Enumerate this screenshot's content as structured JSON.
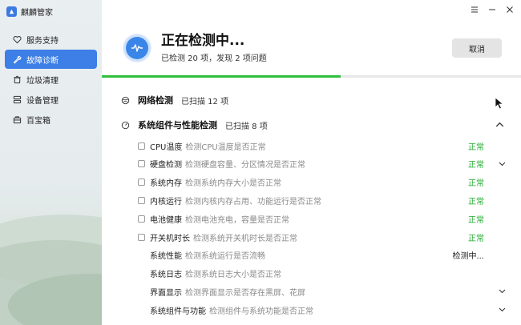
{
  "app": {
    "name": "麒麟管家"
  },
  "sidebar": {
    "items": [
      {
        "label": "服务支持",
        "icon": "heart-icon",
        "active": false
      },
      {
        "label": "故障诊断",
        "icon": "wrench-icon",
        "active": true
      },
      {
        "label": "垃圾清理",
        "icon": "trash-icon",
        "active": false
      },
      {
        "label": "设备管理",
        "icon": "device-icon",
        "active": false
      },
      {
        "label": "百宝箱",
        "icon": "toolbox-icon",
        "active": false
      }
    ]
  },
  "header": {
    "title": "正在检测中...",
    "subtitle": "已检测 20 项，发现 2 项问题",
    "cancel_label": "取消",
    "progress": 0.57
  },
  "sections": [
    {
      "title": "网络检测",
      "meta": "已扫描 12 项"
    },
    {
      "title": "系统组件与性能检测",
      "meta": "已扫描 8 项"
    }
  ],
  "rows": [
    {
      "name": "CPU温度",
      "desc": "检测CPU温度是否正常",
      "status": "正常",
      "state": "ok",
      "checkbox": true,
      "chevron": false
    },
    {
      "name": "硬盘检测",
      "desc": "检测硬盘容量、分区情况是否正常",
      "status": "正常",
      "state": "ok",
      "checkbox": true,
      "chevron": true
    },
    {
      "name": "系统内存",
      "desc": "检测系统内存大小是否正常",
      "status": "正常",
      "state": "ok",
      "checkbox": true,
      "chevron": false
    },
    {
      "name": "内核运行",
      "desc": "检测内核内存占用、功能运行是否正常",
      "status": "正常",
      "state": "ok",
      "checkbox": true,
      "chevron": false
    },
    {
      "name": "电池健康",
      "desc": "检测电池充电，容量是否正常",
      "status": "正常",
      "state": "ok",
      "checkbox": true,
      "chevron": false
    },
    {
      "name": "开关机时长",
      "desc": "检测系统开关机时长是否正常",
      "status": "正常",
      "state": "ok",
      "checkbox": true,
      "chevron": false
    },
    {
      "name": "系统性能",
      "desc": "检测系统运行是否流畅",
      "status": "检测中...",
      "state": "checking",
      "checkbox": false,
      "chevron": false
    },
    {
      "name": "系统日志",
      "desc": "检测系统日志大小是否正常",
      "status": "",
      "state": "pending",
      "checkbox": false,
      "chevron": false
    },
    {
      "name": "界面显示",
      "desc": "检测界面显示是否存在黑屏、花屏",
      "status": "",
      "state": "pending",
      "checkbox": false,
      "chevron": true
    },
    {
      "name": "系统组件与功能",
      "desc": "检测组件与系统功能是否正常",
      "status": "",
      "state": "pending",
      "checkbox": false,
      "chevron": true
    }
  ]
}
